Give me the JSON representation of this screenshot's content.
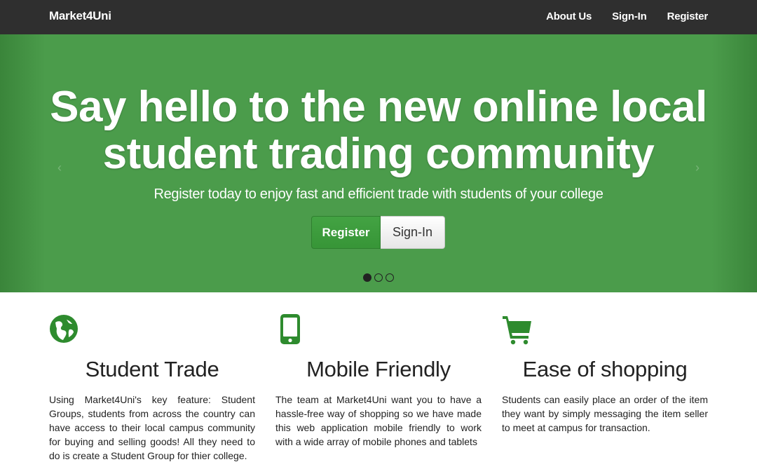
{
  "navbar": {
    "brand": "Market4Uni",
    "links": [
      "About Us",
      "Sign-In",
      "Register"
    ]
  },
  "hero": {
    "title_line1": "Say hello to the new online local",
    "title_line2": "student trading community",
    "subtitle": "Register today to enjoy fast and efficient trade with students of your college",
    "register_label": "Register",
    "signin_label": "Sign-In",
    "prev_arrow": "‹",
    "next_arrow": "›",
    "slide_count": 3,
    "active_slide": 1
  },
  "features": [
    {
      "icon": "globe-icon",
      "title": "Student Trade",
      "text": "Using Market4Uni's key feature: Student Groups, students from across the country can have access to their local campus community for buying and selling goods! All they need to do is create a Student Group for thier college."
    },
    {
      "icon": "mobile-phone-icon",
      "title": "Mobile Friendly",
      "text": "The team at Market4Uni want you to have a hassle-free way of shopping so we have made this web application mobile friendly to work with a wide array of mobile phones and tablets"
    },
    {
      "icon": "shopping-cart-icon",
      "title": "Ease of shopping",
      "text": "Students can easily place an order of the item they want by simply messaging the item seller to meet at campus for transaction."
    }
  ],
  "colors": {
    "navbar_bg": "#2f2f2f",
    "hero_green": "#4b9c4b",
    "icon_green": "#2e8b2e",
    "button_green": "#3d9c3d"
  }
}
